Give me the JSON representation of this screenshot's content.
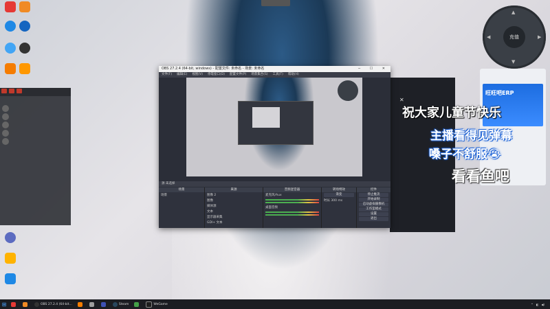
{
  "top_notice": "",
  "desktop_icons": [
    {
      "label": "",
      "color": "#e53935"
    },
    {
      "label": "",
      "color": "#f08a24"
    },
    {
      "label": "",
      "color": "#1e88e5"
    },
    {
      "label": "",
      "color": "#1565c0"
    },
    {
      "label": "",
      "color": "#42a5f5"
    },
    {
      "label": "",
      "color": "#333333"
    },
    {
      "label": "",
      "color": "#f57c00"
    },
    {
      "label": "",
      "color": "#ff9800"
    }
  ],
  "joystick": {
    "center_label": "充值"
  },
  "chat": {
    "lines": [
      "",
      "",
      "",
      "",
      "",
      "",
      "",
      "",
      ""
    ],
    "rows": [
      "",
      "",
      "",
      "",
      "",
      "",
      ""
    ]
  },
  "obs": {
    "title": "OBS 27.2.4 (64-bit, windows) - 配置文件: 未命名 - 场景: 未命名",
    "menu": [
      "文件(F)",
      "编辑(E)",
      "视图(V)",
      "停靠窗口(D)",
      "配置文件(P)",
      "场景集合(S)",
      "工具(T)",
      "帮助(H)"
    ],
    "context_bar": "源 未选择",
    "docks": {
      "scenes": {
        "header": "场景",
        "items": [
          "场景"
        ]
      },
      "sources": {
        "header": "来源",
        "items": [
          "图像 2",
          "图像",
          "媒体源",
          "文本",
          "显示器采集",
          "GDI+ 文本"
        ]
      },
      "mixer": {
        "header": "音频混音器",
        "items": [
          "麦克风/Aux",
          "桌面音频"
        ]
      },
      "transitions": {
        "header": "转场特效",
        "items": [
          "渐变",
          "时长 300 ms"
        ]
      },
      "controls": {
        "header": "控件",
        "items": [
          "停止推流",
          "开始录制",
          "启动虚拟摄像机",
          "工作室模式",
          "设置",
          "退出"
        ]
      }
    }
  },
  "overlay": {
    "line1": "祝大家儿童节快乐",
    "line2": "主播看得见弹幕",
    "line3": "嗓子不舒服😭",
    "line4": "看看鱼吧"
  },
  "erp": {
    "brand": "旺旺吧ERP",
    "tagline": ""
  },
  "taskbar": {
    "items": [
      {
        "label": "",
        "color": "#e53935"
      },
      {
        "label": "",
        "color": "#f08a24"
      },
      {
        "label": "OBS 27.2.4 (64-bit...",
        "color": "#333333"
      },
      {
        "label": "",
        "color": "#f57c00"
      },
      {
        "label": "",
        "color": "#9e9e9e"
      },
      {
        "label": "",
        "color": "#3f51b5"
      },
      {
        "label": "Steam",
        "color": "#2a475e"
      },
      {
        "label": "",
        "color": "#43a047"
      },
      {
        "label": "WeGame",
        "color": "#1e1e1e"
      }
    ],
    "time": "",
    "date": ""
  }
}
